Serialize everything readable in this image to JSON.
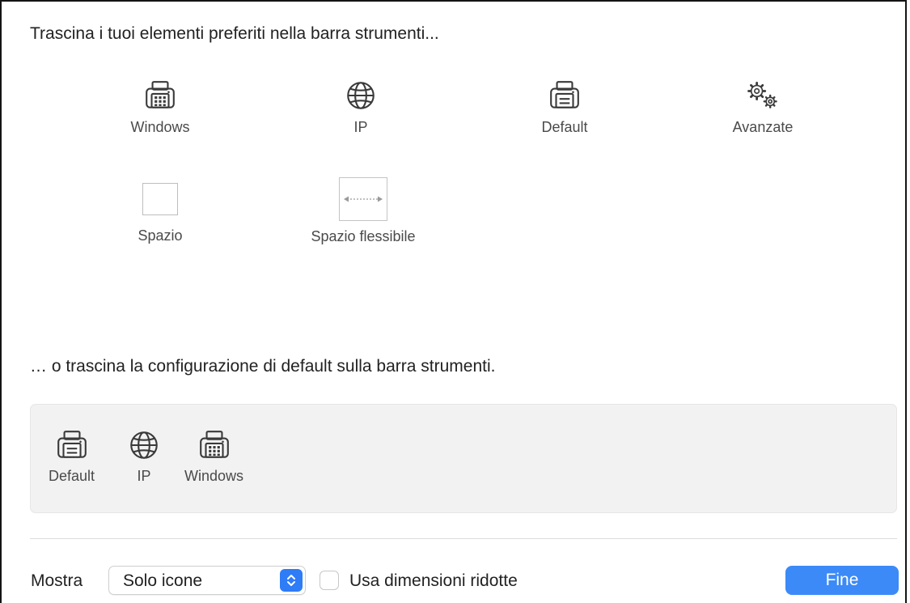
{
  "palette": {
    "heading": "Trascina i tuoi elementi preferiti nella barra strumenti...",
    "items": [
      {
        "label": "Windows",
        "icon": "printer-windows-icon"
      },
      {
        "label": "IP",
        "icon": "globe-icon"
      },
      {
        "label": "Default",
        "icon": "printer-default-icon"
      },
      {
        "label": "Avanzate",
        "icon": "gears-icon"
      },
      {
        "label": "Spazio",
        "icon": "space-icon"
      },
      {
        "label": "Spazio flessibile",
        "icon": "flexible-space-icon"
      }
    ]
  },
  "default_set": {
    "heading": "… o trascina la configurazione di default sulla barra strumenti.",
    "items": [
      {
        "label": "Default",
        "icon": "printer-default-icon"
      },
      {
        "label": "IP",
        "icon": "globe-icon"
      },
      {
        "label": "Windows",
        "icon": "printer-windows-icon"
      }
    ]
  },
  "footer": {
    "show_label": "Mostra",
    "show_value": "Solo icone",
    "small_size_label": "Usa dimensioni ridotte",
    "small_size_checked": false,
    "done_label": "Fine"
  },
  "colors": {
    "accent": "#3b8af7",
    "icon": "#3a3a3a"
  }
}
